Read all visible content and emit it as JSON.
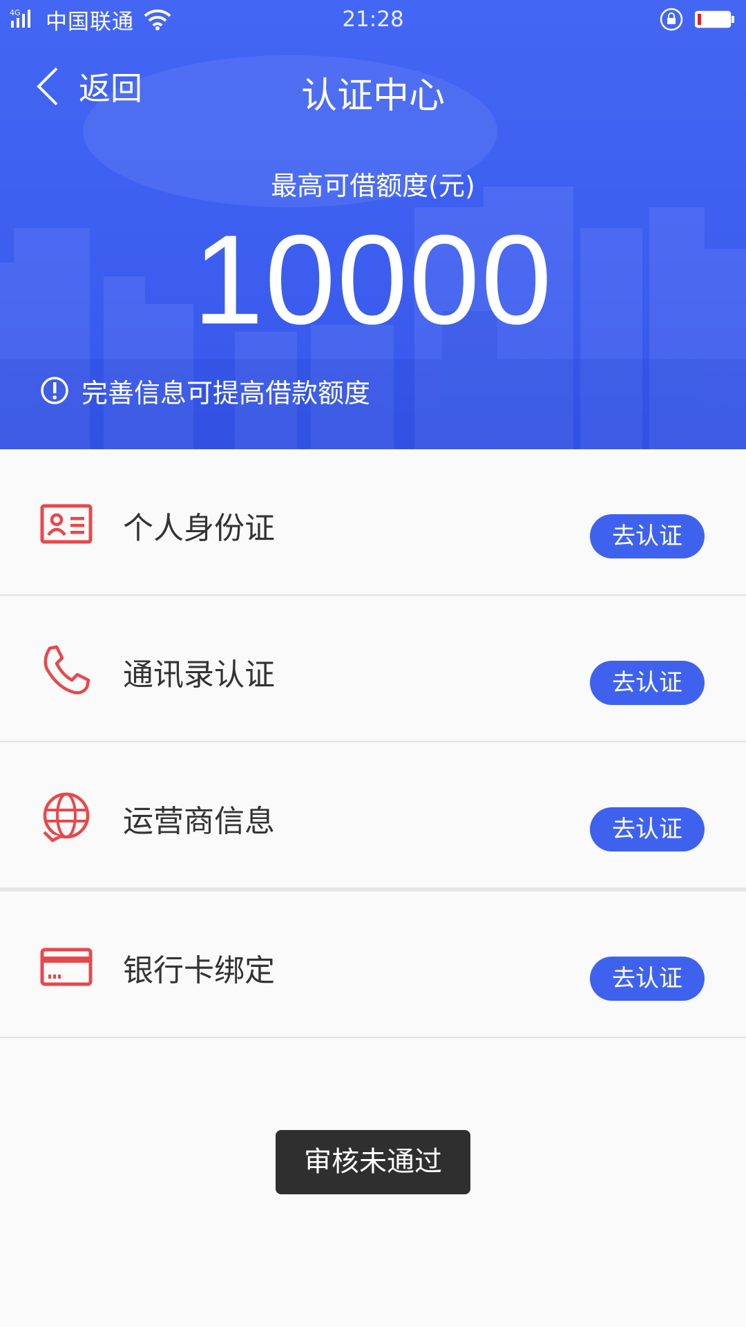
{
  "statusbar": {
    "network": "4G",
    "carrier": "中国联通",
    "time": "21:28"
  },
  "nav": {
    "back_label": "返回",
    "title": "认证中心"
  },
  "hero": {
    "quota_label": "最高可借额度(元)",
    "quota_amount": "10000",
    "hint": "完善信息可提高借款额度"
  },
  "items": [
    {
      "label": "个人身份证",
      "button": "去认证",
      "icon": "id-card-icon"
    },
    {
      "label": "通讯录认证",
      "button": "去认证",
      "icon": "phone-icon"
    },
    {
      "label": "运营商信息",
      "button": "去认证",
      "icon": "globe-icon"
    },
    {
      "label": "银行卡绑定",
      "button": "去认证",
      "icon": "bank-card-icon"
    }
  ],
  "toast": "审核未通过",
  "colors": {
    "primary": "#3f62ee",
    "icon_red": "#e8484b",
    "hero_blue": "#4466f4"
  }
}
